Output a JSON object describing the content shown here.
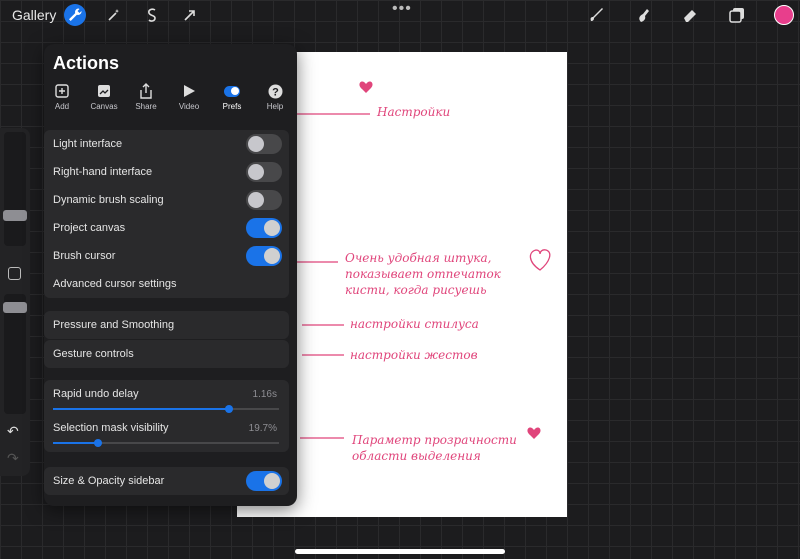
{
  "topbar": {
    "gallery_label": "Gallery",
    "tools_left": [
      "wrench-icon",
      "magic-wand-icon",
      "selection-icon",
      "transform-arrow-icon"
    ],
    "menu_dots": "•••",
    "tools_right": [
      "brush-icon",
      "smudge-icon",
      "eraser-icon",
      "layers-icon"
    ],
    "current_color": "#e83e8c"
  },
  "actions": {
    "title": "Actions",
    "tabs": [
      {
        "label": "Add",
        "icon": "add-file-icon"
      },
      {
        "label": "Canvas",
        "icon": "canvas-icon"
      },
      {
        "label": "Share",
        "icon": "share-icon"
      },
      {
        "label": "Video",
        "icon": "play-icon"
      },
      {
        "label": "Prefs",
        "icon": "toggle-icon"
      },
      {
        "label": "Help",
        "icon": "help-icon"
      }
    ],
    "active_tab": "Prefs",
    "toggles": [
      {
        "label": "Light interface",
        "on": false
      },
      {
        "label": "Right-hand interface",
        "on": false
      },
      {
        "label": "Dynamic brush scaling",
        "on": false
      },
      {
        "label": "Project canvas",
        "on": true
      },
      {
        "label": "Brush cursor",
        "on": true
      }
    ],
    "advanced_cursor": "Advanced cursor settings",
    "pressure": "Pressure and Smoothing",
    "gestures": "Gesture controls",
    "sliders": [
      {
        "label": "Rapid undo delay",
        "value": "1.16s",
        "fraction": 0.78
      },
      {
        "label": "Selection mask visibility",
        "value": "19.7%",
        "fraction": 0.2
      }
    ],
    "sidebar_toggle": {
      "label": "Size & Opacity sidebar",
      "on": true
    }
  },
  "annotations": {
    "prefs_note": "Настройки",
    "cursor_note": [
      "Очень удобная штука,",
      "показывает отпечаток",
      "кисти, когда рисуешь"
    ],
    "pressure_note": "настройки стилуса",
    "gesture_note": "настройки жестов",
    "mask_note": [
      "Параметр прозрачности",
      "области выделения"
    ]
  },
  "colors": {
    "accent": "#1a73e8",
    "annotation": "#e0457b"
  }
}
